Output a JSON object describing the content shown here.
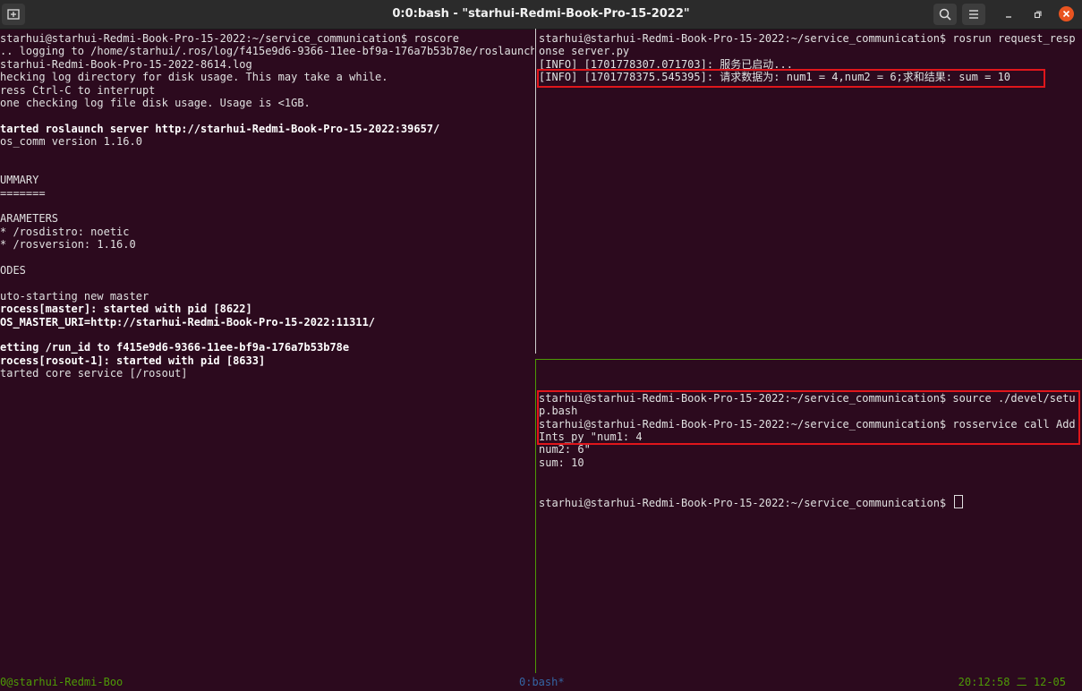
{
  "window": {
    "title": "0:0:bash - \"starhui-Redmi-Book-Pro-15-2022\""
  },
  "colors": {
    "background": "#2c0a1e",
    "titlebar": "#2b2b2b",
    "status_green": "#4e9a06",
    "status_blue": "#3465a4",
    "highlight_red": "#e0161b",
    "close_orange": "#e95420"
  },
  "icons": {
    "new_tab": "new-tab-icon",
    "search": "search-icon",
    "menu": "hamburger-menu-icon",
    "minimize": "minimize-icon",
    "maximize": "maximize-icon",
    "close": "close-icon"
  },
  "left_pane": {
    "lines": [
      {
        "text": "starhui@starhui-Redmi-Book-Pro-15-2022:~/service_communication$ roscore",
        "bold": false
      },
      {
        "text": ".. logging to /home/starhui/.ros/log/f415e9d6-9366-11ee-bf9a-176a7b53b78e/roslaunch",
        "bold": false
      },
      {
        "text": "starhui-Redmi-Book-Pro-15-2022-8614.log",
        "bold": false
      },
      {
        "text": "hecking log directory for disk usage. This may take a while.",
        "bold": false
      },
      {
        "text": "ress Ctrl-C to interrupt",
        "bold": false
      },
      {
        "text": "one checking log file disk usage. Usage is <1GB.",
        "bold": false
      },
      {
        "text": "",
        "bold": false
      },
      {
        "text": "tarted roslaunch server http://starhui-Redmi-Book-Pro-15-2022:39657/",
        "bold": true
      },
      {
        "text": "os_comm version 1.16.0",
        "bold": false
      },
      {
        "text": "",
        "bold": false
      },
      {
        "text": "",
        "bold": false
      },
      {
        "text": "UMMARY",
        "bold": false
      },
      {
        "text": "=======",
        "bold": false
      },
      {
        "text": "",
        "bold": false
      },
      {
        "text": "ARAMETERS",
        "bold": false
      },
      {
        "text": "* /rosdistro: noetic",
        "bold": false
      },
      {
        "text": "* /rosversion: 1.16.0",
        "bold": false
      },
      {
        "text": "",
        "bold": false
      },
      {
        "text": "ODES",
        "bold": false
      },
      {
        "text": "",
        "bold": false
      },
      {
        "text": "uto-starting new master",
        "bold": false
      },
      {
        "text": "rocess[master]: started with pid [8622]",
        "bold": true
      },
      {
        "text": "OS_MASTER_URI=http://starhui-Redmi-Book-Pro-15-2022:11311/",
        "bold": true
      },
      {
        "text": "",
        "bold": false
      },
      {
        "text": "etting /run_id to f415e9d6-9366-11ee-bf9a-176a7b53b78e",
        "bold": true
      },
      {
        "text": "rocess[rosout-1]: started with pid [8633]",
        "bold": true
      },
      {
        "text": "tarted core service [/rosout]",
        "bold": false
      }
    ]
  },
  "right_top_pane": {
    "lines": [
      {
        "text": "starhui@starhui-Redmi-Book-Pro-15-2022:~/service_communication$ rosrun request_resp"
      },
      {
        "text": "onse server.py"
      },
      {
        "text": "[INFO] [1701778307.071703]: 服务已启动..."
      },
      {
        "text": "[INFO] [1701778375.545395]: 请求数据为: num1 = 4,num2 = 6;求和结果: sum = 10"
      }
    ]
  },
  "right_bottom_pane": {
    "lines": [
      {
        "text": "starhui@starhui-Redmi-Book-Pro-15-2022:~/service_communication$ source ./devel/setu"
      },
      {
        "text": "p.bash"
      },
      {
        "text": "starhui@starhui-Redmi-Book-Pro-15-2022:~/service_communication$ rosservice call Add"
      },
      {
        "text": "Ints_py \"num1: 4"
      },
      {
        "text": "num2: 6\""
      },
      {
        "text": "sum: 10"
      }
    ],
    "prompt": "starhui@starhui-Redmi-Book-Pro-15-2022:~/service_communication$ "
  },
  "status_bar": {
    "session": "0@starhui-Redmi-Boo",
    "window": "0:bash*",
    "clock": "20:12:58 二 12-05"
  }
}
